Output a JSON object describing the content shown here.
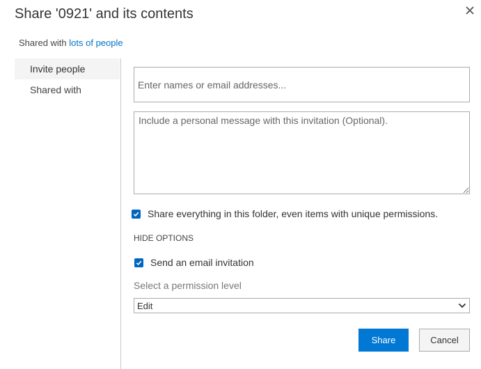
{
  "dialog": {
    "title": "Share '0921' and its contents",
    "shared_with_prefix": "Shared with",
    "shared_with_link": "lots of people"
  },
  "nav": {
    "items": [
      {
        "label": "Invite people",
        "active": true
      },
      {
        "label": "Shared with",
        "active": false
      }
    ]
  },
  "invite": {
    "names_placeholder": "Enter names or email addresses...",
    "names_value": "",
    "message_placeholder": "Include a personal message with this invitation (Optional).",
    "message_value": "",
    "share_everything_label": "Share everything in this folder, even items with unique permissions.",
    "share_everything_checked": true,
    "hide_options_label": "HIDE OPTIONS",
    "send_email_label": "Send an email invitation",
    "send_email_checked": true,
    "permission_label": "Select a permission level",
    "permission_value": "Edit"
  },
  "actions": {
    "share_label": "Share",
    "cancel_label": "Cancel"
  },
  "colors": {
    "accent": "#0078d4",
    "link": "#0072c6"
  }
}
